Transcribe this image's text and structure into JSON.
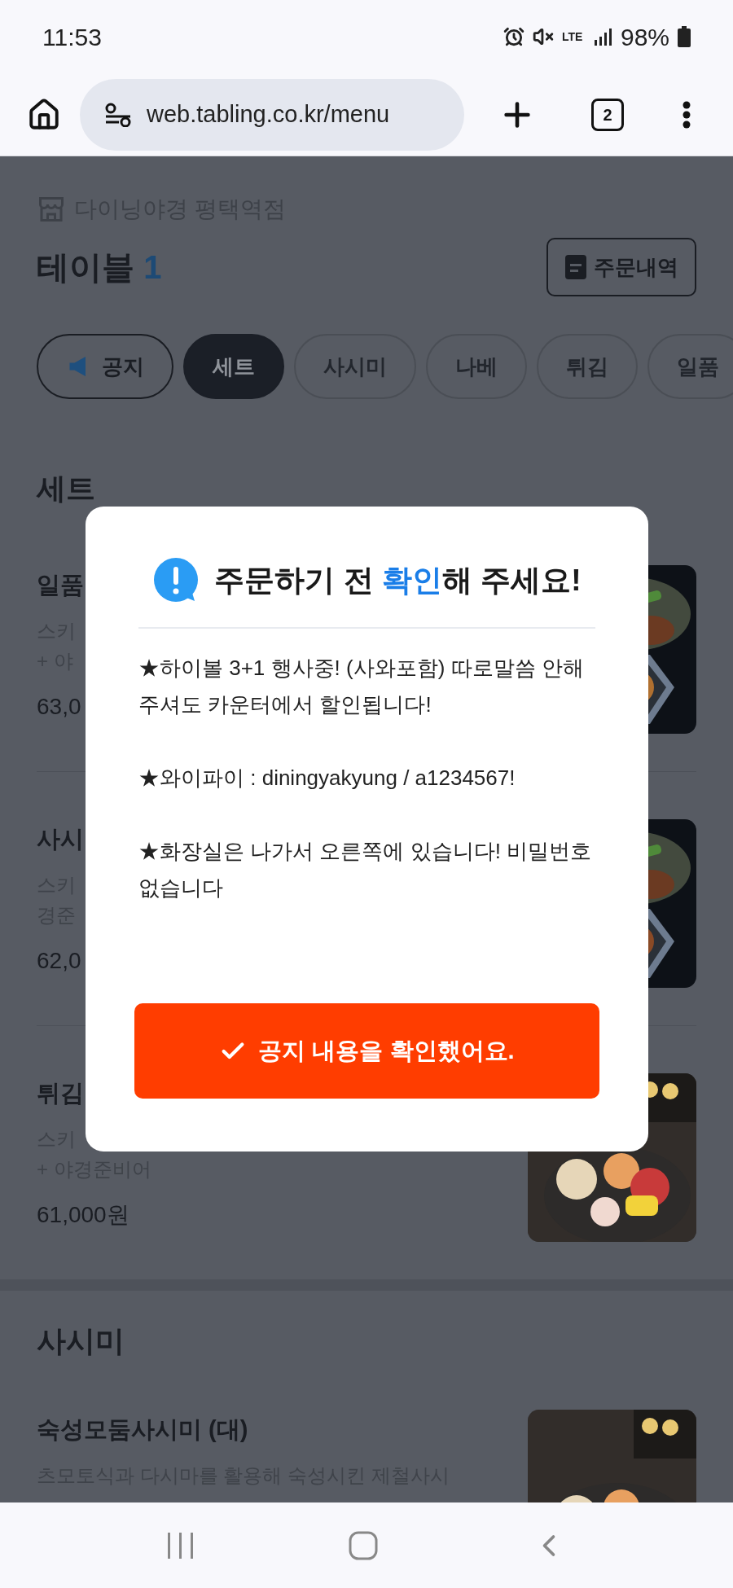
{
  "status_bar": {
    "time": "11:53",
    "network": "LTE",
    "battery": "98%"
  },
  "browser": {
    "url": "web.tabling.co.kr/menu",
    "tab_count": "2"
  },
  "store": {
    "name": "다이닝야경 평택역점",
    "table_label": "테이블",
    "table_number": "1",
    "order_history_button": "주문내역"
  },
  "categories": [
    {
      "label": "공지",
      "kind": "notice",
      "selected": false
    },
    {
      "label": "세트",
      "kind": "category",
      "selected": true
    },
    {
      "label": "사시미",
      "kind": "category",
      "selected": false
    },
    {
      "label": "나베",
      "kind": "category",
      "selected": false
    },
    {
      "label": "튀김",
      "kind": "category",
      "selected": false
    },
    {
      "label": "일품",
      "kind": "category",
      "selected": false
    }
  ],
  "sections": [
    {
      "title": "세트",
      "items": [
        {
          "name": "일품",
          "description": [
            "스키",
            "+ 야"
          ],
          "price": "63,0"
        },
        {
          "name": "사시",
          "description": [
            "스키",
            "경준"
          ],
          "price": "62,0"
        },
        {
          "name": "튀김",
          "description": [
            "스키",
            "+ 야경준비어"
          ],
          "price": "61,000원"
        }
      ]
    },
    {
      "title": "사시미",
      "items": [
        {
          "name": "숙성모둠사시미 (대)",
          "description": [
            "츠모토식과 다시마를 활용해 숙성시킨 제철사시"
          ]
        }
      ]
    }
  ],
  "modal": {
    "title_before": "주문하기 전 ",
    "title_highlight": "확인",
    "title_after": "해 주세요!",
    "paragraphs": [
      "★하이볼 3+1 행사중! (사와포함) 따로말씀 안해주셔도 카운터에서 할인됩니다!",
      "★와이파이 : diningyakyung / a1234567!",
      "★화장실은 나가서 오른쪽에 있습니다! 비밀번호 없습니다"
    ],
    "confirm_button": "공지 내용을 확인했어요."
  }
}
